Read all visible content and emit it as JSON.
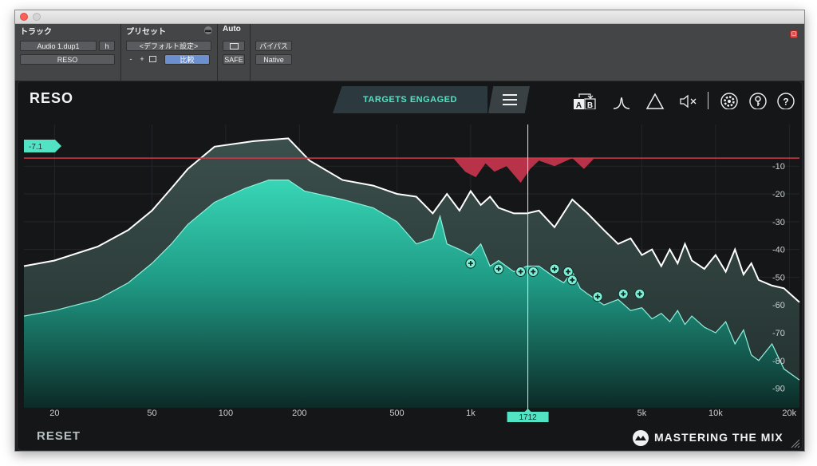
{
  "window": {
    "title_bar": ""
  },
  "header": {
    "track": {
      "label": "トラック",
      "name": "Audio 1.dup1",
      "h": "h",
      "insert": "RESO"
    },
    "preset": {
      "label": "プリセット",
      "name": "<デフォルト設定>",
      "minus": "-",
      "plus": "+",
      "compare": "比較"
    },
    "auto": {
      "label": "Auto",
      "safe": "SAFE"
    },
    "bypass": {
      "bypass_label": "バイパス",
      "native_label": "Native"
    }
  },
  "plugin": {
    "title": "RESO",
    "targets_label": "TARGETS ENGAGED",
    "reset_label": "RESET",
    "brand": "MASTERING THE MIX",
    "threshold_badge": "-7.1",
    "freq_marker": "1712",
    "icons": [
      "ab-compare-icon",
      "bell-filter-icon",
      "triangle-icon",
      "speaker-mute-icon",
      "gear-icon",
      "key-icon",
      "help-icon"
    ]
  },
  "colors": {
    "accent": "#52e3c4",
    "threshold_red": "#d03a48",
    "background": "#141617"
  },
  "chart_data": {
    "type": "area",
    "x_scale": "log",
    "xlim": [
      15,
      22000
    ],
    "ylim": [
      -97,
      5
    ],
    "x_ticks": [
      {
        "v": 20,
        "label": "20"
      },
      {
        "v": 50,
        "label": "50"
      },
      {
        "v": 100,
        "label": "100"
      },
      {
        "v": 200,
        "label": "200"
      },
      {
        "v": 500,
        "label": "500"
      },
      {
        "v": 1000,
        "label": "1k"
      },
      {
        "v": 5000,
        "label": "5k"
      },
      {
        "v": 10000,
        "label": "10k"
      },
      {
        "v": 20000,
        "label": "20k"
      }
    ],
    "y_ticks": [
      {
        "v": -10,
        "label": "-10"
      },
      {
        "v": -20,
        "label": "-20"
      },
      {
        "v": -30,
        "label": "-30"
      },
      {
        "v": -40,
        "label": "-40"
      },
      {
        "v": -50,
        "label": "-50"
      },
      {
        "v": -60,
        "label": "-60"
      },
      {
        "v": -70,
        "label": "-70"
      },
      {
        "v": -80,
        "label": "-80"
      },
      {
        "v": -90,
        "label": "-90"
      }
    ],
    "threshold_db": -7.1,
    "marker_hz": 1712,
    "series": [
      {
        "role": "envelope",
        "points": [
          [
            15,
            -46
          ],
          [
            20,
            -44
          ],
          [
            30,
            -39
          ],
          [
            40,
            -33
          ],
          [
            50,
            -26
          ],
          [
            60,
            -18
          ],
          [
            70,
            -11
          ],
          [
            90,
            -3
          ],
          [
            130,
            -1
          ],
          [
            180,
            0
          ],
          [
            220,
            -8
          ],
          [
            300,
            -15
          ],
          [
            400,
            -17
          ],
          [
            500,
            -20
          ],
          [
            600,
            -21
          ],
          [
            700,
            -27
          ],
          [
            800,
            -20
          ],
          [
            900,
            -26
          ],
          [
            1000,
            -19
          ],
          [
            1100,
            -24
          ],
          [
            1200,
            -21
          ],
          [
            1300,
            -25
          ],
          [
            1500,
            -27
          ],
          [
            1700,
            -27
          ],
          [
            1900,
            -26
          ],
          [
            2200,
            -32
          ],
          [
            2600,
            -22
          ],
          [
            3000,
            -27
          ],
          [
            3500,
            -33
          ],
          [
            4000,
            -38
          ],
          [
            4500,
            -36
          ],
          [
            5000,
            -42
          ],
          [
            5500,
            -40
          ],
          [
            6000,
            -46
          ],
          [
            6500,
            -40
          ],
          [
            7000,
            -45
          ],
          [
            7500,
            -38
          ],
          [
            8000,
            -44
          ],
          [
            9000,
            -47
          ],
          [
            10000,
            -42
          ],
          [
            11000,
            -48
          ],
          [
            12000,
            -40
          ],
          [
            13000,
            -49
          ],
          [
            14000,
            -45
          ],
          [
            15000,
            -51
          ],
          [
            17000,
            -53
          ],
          [
            19000,
            -54
          ],
          [
            22000,
            -59
          ]
        ]
      },
      {
        "role": "filled_spectrum",
        "points": [
          [
            15,
            -64
          ],
          [
            20,
            -62
          ],
          [
            30,
            -58
          ],
          [
            40,
            -52
          ],
          [
            50,
            -45
          ],
          [
            60,
            -38
          ],
          [
            70,
            -31
          ],
          [
            90,
            -23
          ],
          [
            120,
            -18
          ],
          [
            150,
            -15
          ],
          [
            180,
            -15
          ],
          [
            210,
            -19
          ],
          [
            300,
            -22
          ],
          [
            400,
            -25
          ],
          [
            500,
            -30
          ],
          [
            600,
            -38
          ],
          [
            700,
            -36
          ],
          [
            750,
            -28
          ],
          [
            800,
            -38
          ],
          [
            900,
            -40
          ],
          [
            1000,
            -42
          ],
          [
            1100,
            -38
          ],
          [
            1200,
            -46
          ],
          [
            1300,
            -44
          ],
          [
            1500,
            -48
          ],
          [
            1700,
            -46
          ],
          [
            1900,
            -46
          ],
          [
            2200,
            -50
          ],
          [
            2400,
            -52
          ],
          [
            2600,
            -48
          ],
          [
            2800,
            -54
          ],
          [
            3000,
            -56
          ],
          [
            3500,
            -60
          ],
          [
            4000,
            -58
          ],
          [
            4500,
            -62
          ],
          [
            5000,
            -61
          ],
          [
            5500,
            -65
          ],
          [
            6000,
            -63
          ],
          [
            6500,
            -66
          ],
          [
            7000,
            -62
          ],
          [
            7500,
            -67
          ],
          [
            8000,
            -64
          ],
          [
            9000,
            -68
          ],
          [
            10000,
            -70
          ],
          [
            11000,
            -66
          ],
          [
            12000,
            -74
          ],
          [
            13000,
            -69
          ],
          [
            14000,
            -78
          ],
          [
            15000,
            -80
          ],
          [
            17000,
            -74
          ],
          [
            19000,
            -83
          ],
          [
            22000,
            -87
          ]
        ]
      },
      {
        "role": "resonance_dips",
        "points": [
          [
            850,
            -7.1
          ],
          [
            950,
            -12
          ],
          [
            1050,
            -14
          ],
          [
            1150,
            -9
          ],
          [
            1250,
            -12
          ],
          [
            1400,
            -10
          ],
          [
            1600,
            -16
          ],
          [
            1750,
            -11
          ],
          [
            1900,
            -8
          ],
          [
            2200,
            -10
          ],
          [
            2600,
            -7.1
          ],
          [
            2900,
            -11
          ],
          [
            3200,
            -7.1
          ]
        ]
      }
    ],
    "target_nodes": [
      {
        "hz": 1000,
        "db": -45
      },
      {
        "hz": 1300,
        "db": -47
      },
      {
        "hz": 1600,
        "db": -48
      },
      {
        "hz": 1800,
        "db": -48
      },
      {
        "hz": 2200,
        "db": -47
      },
      {
        "hz": 2500,
        "db": -48
      },
      {
        "hz": 2600,
        "db": -51
      },
      {
        "hz": 3300,
        "db": -57
      },
      {
        "hz": 4200,
        "db": -56
      },
      {
        "hz": 4900,
        "db": -56
      }
    ]
  }
}
